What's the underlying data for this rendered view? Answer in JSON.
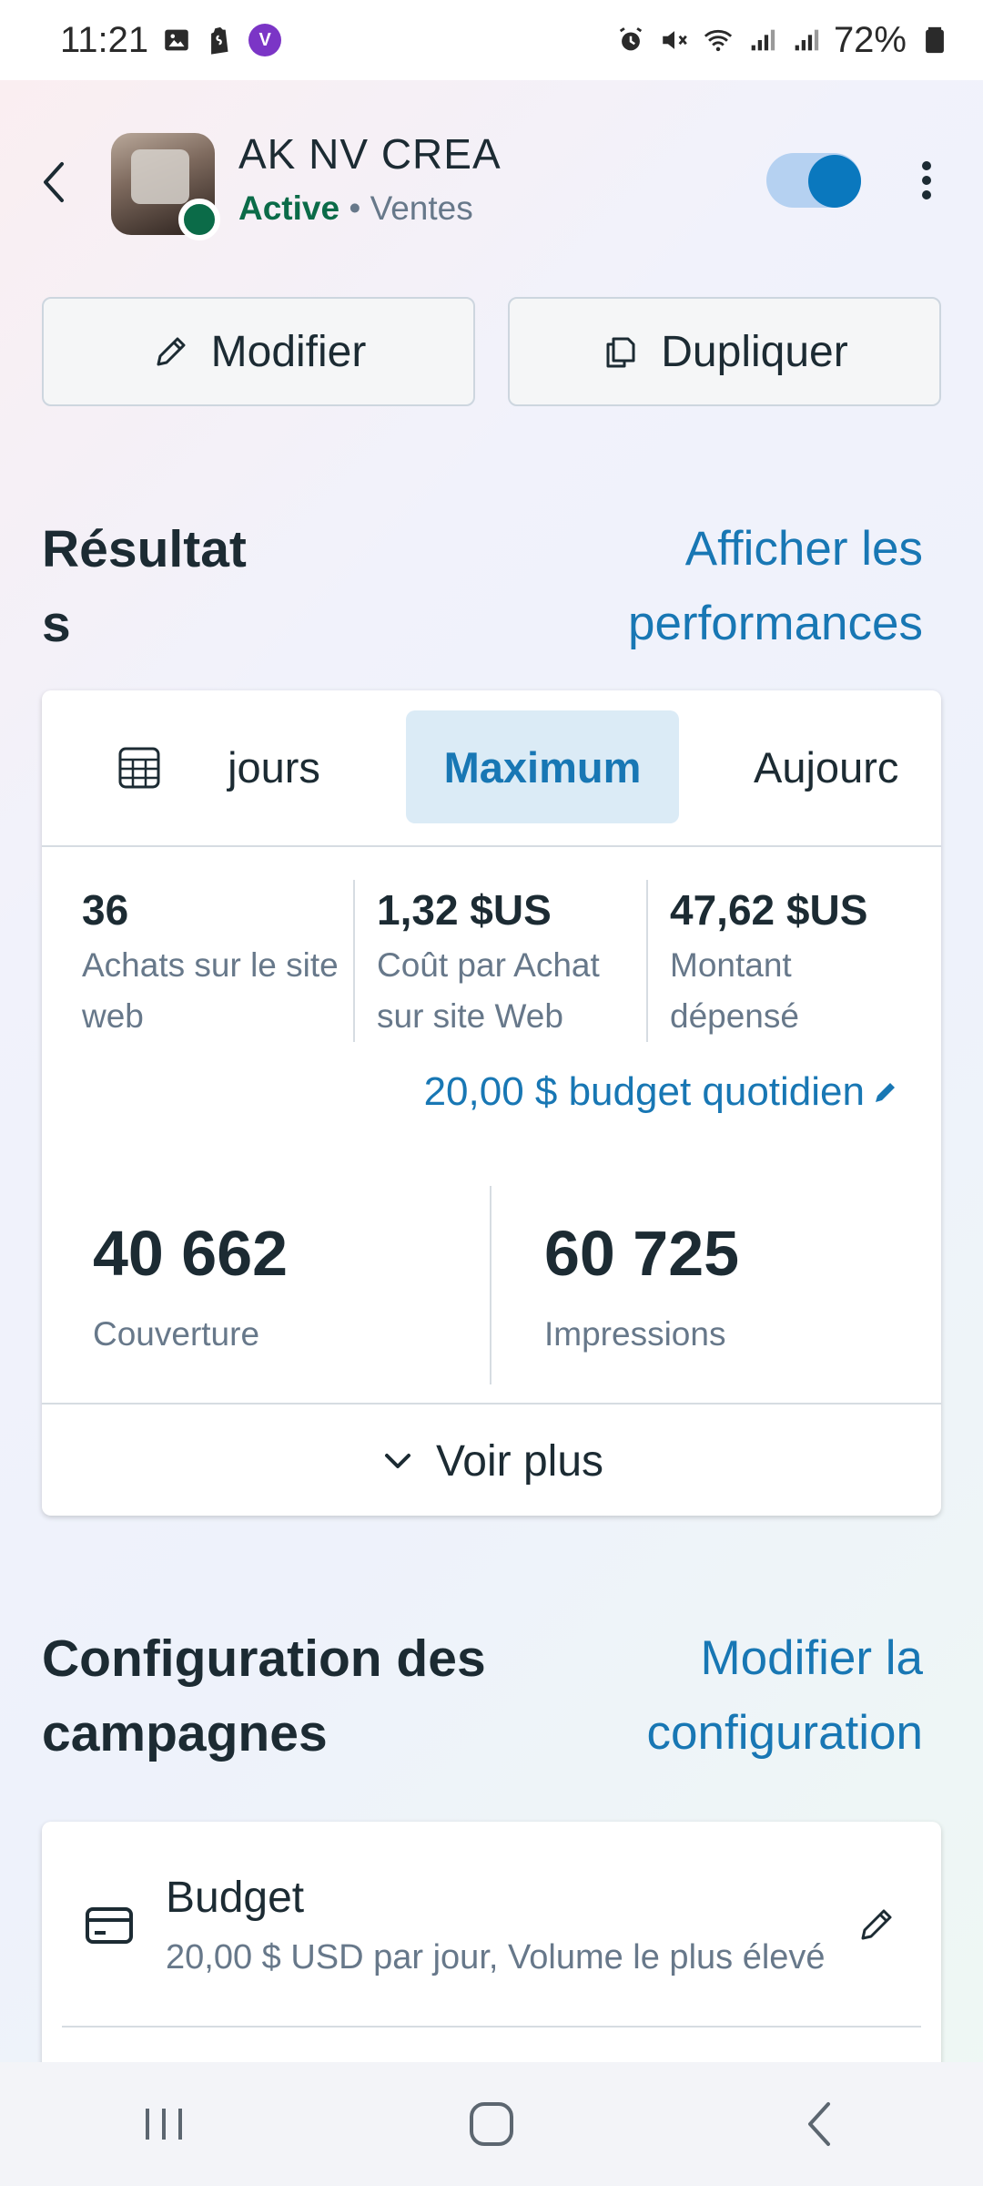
{
  "status_bar": {
    "time": "11:21",
    "battery": "72%",
    "viber_glyph": "V"
  },
  "header": {
    "campaign_name": "AK NV CREA",
    "status": "Active",
    "separator": " • ",
    "objective": "Ventes"
  },
  "actions": {
    "edit_label": "Modifier",
    "duplicate_label": "Dupliquer"
  },
  "results": {
    "title_line1": "Résultat",
    "title_line2": "s",
    "link_line1": "Afficher les",
    "link_line2": "performances",
    "tabs": [
      "jours",
      "Maximum",
      "Aujourc"
    ],
    "selected_tab": "Maximum",
    "metrics": [
      {
        "value": "36",
        "label_line1": "Achats sur le site",
        "label_line2": "web"
      },
      {
        "value": "1,32 $US",
        "label_line1": "Coût par Achat",
        "label_line2": "sur site Web"
      },
      {
        "value": "47,62 $US",
        "label_line1": "Montant",
        "label_line2": "dépensé"
      }
    ],
    "budget_link": "20,00 $ budget quotidien",
    "big_metrics": [
      {
        "value": "40 662",
        "label": "Couverture"
      },
      {
        "value": "60 725",
        "label": "Impressions"
      }
    ],
    "see_more": "Voir plus"
  },
  "config": {
    "title_line1": "Configuration des",
    "title_line2": "campagnes",
    "link_line1": "Modifier la",
    "link_line2": "configuration",
    "budget_title": "Budget",
    "budget_desc": "20,00 $ USD par jour, Volume le plus élevé"
  },
  "colors": {
    "accent": "#1877b4",
    "active_green": "#0b6b48",
    "toggle_on": "#0a78be"
  },
  "icons": [
    "back-arrow-icon",
    "more-vert-icon",
    "pencil-icon",
    "copy-icon",
    "calendar-grid-icon",
    "chevron-down-icon",
    "credit-card-icon"
  ]
}
